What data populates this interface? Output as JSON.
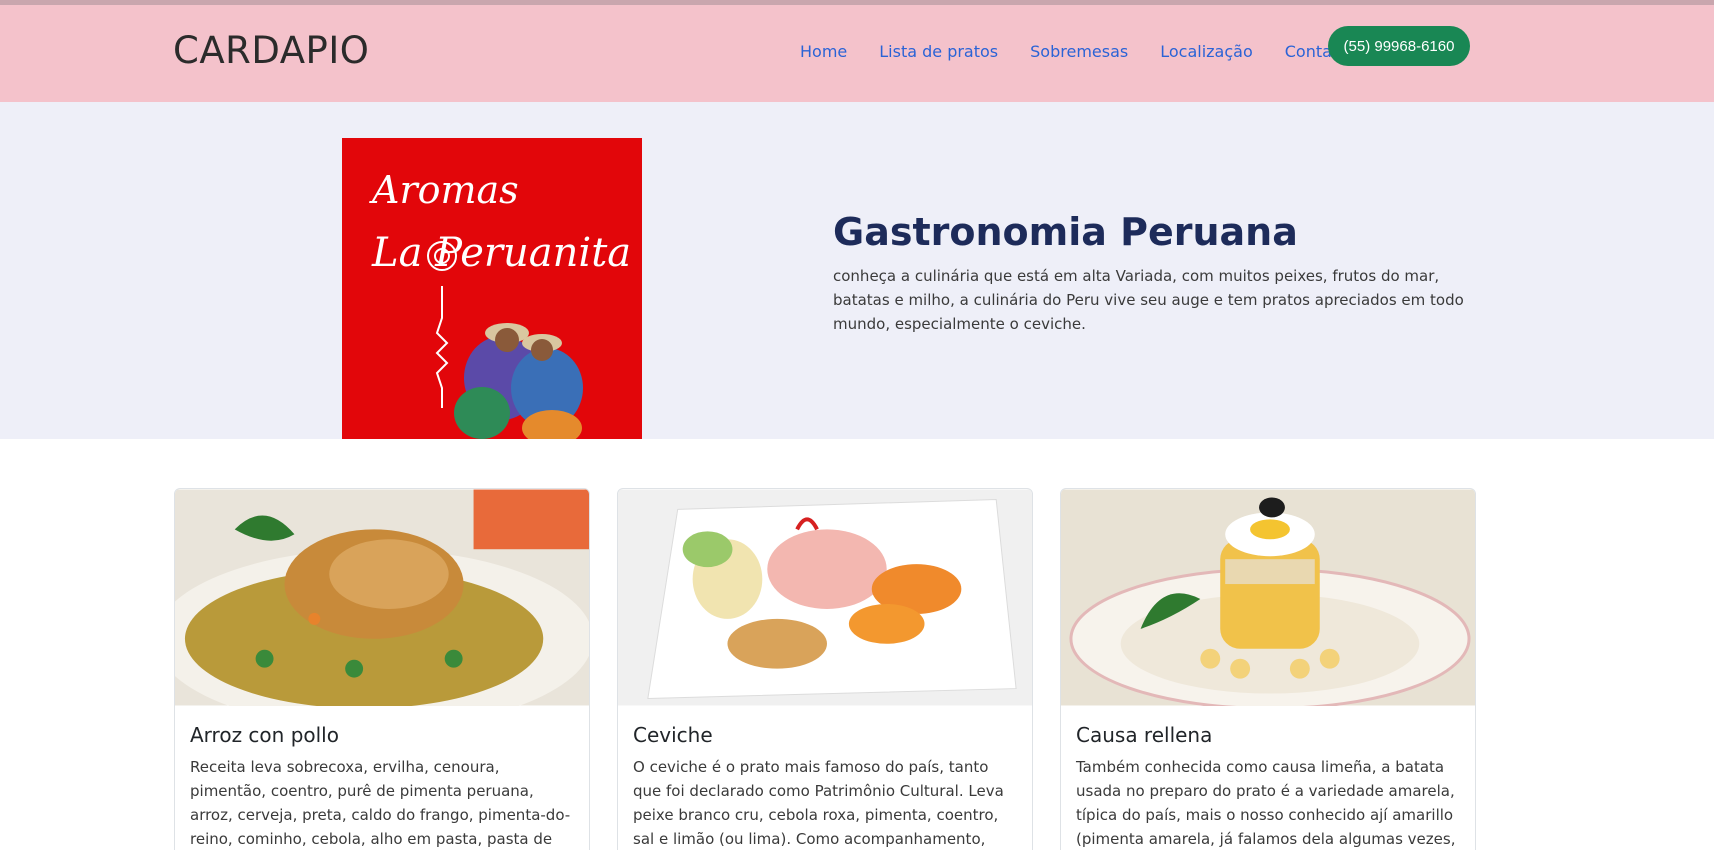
{
  "header": {
    "brand": "CARDAPIO",
    "nav": [
      "Home",
      "Lista de pratos",
      "Sobremesas",
      "Localização",
      "Contato"
    ],
    "phone_button": "(55) 99968-6160",
    "background": "#f4c2cb",
    "link_color": "#2a63d6",
    "button_color": "#198754"
  },
  "hero": {
    "logo_line1": "Aromas",
    "logo_line2": "La Peruanita",
    "title": "Gastronomia Peruana",
    "text": "conheça a culinária que está em alta Variada, com muitos peixes, frutos do mar, batatas e milho, a culinária do Peru vive seu auge e tem pratos apreciados em todo mundo, especialmente o ceviche.",
    "background": "#eeeff8",
    "logo_color": "#e2060a"
  },
  "cards": [
    {
      "title": "Arroz con pollo",
      "text": "Receita leva sobrecoxa, ervilha, cenoura, pimentão, coentro, purê de pimenta peruana, arroz, cerveja, preta, caldo do frango, pimenta-do-reino, cominho, cebola, alho em pasta, pasta de pimentão, cebola e",
      "image": "rice-with-chicken-photo"
    },
    {
      "title": "Ceviche",
      "text": "O ceviche é o prato mais famoso do país, tanto que foi declarado como Patrimônio Cultural. Leva peixe branco cru, cebola roxa, pimenta, coentro, sal e limão (ou lima). Como acompanhamento, costuma-se servir",
      "image": "ceviche-photo"
    },
    {
      "title": "Causa rellena",
      "text": "Também conhecida como causa limeña, a batata usada no preparo do prato é a variedade amarela, típica do país, mais o nosso conhecido ají amarillo (pimenta amarela, já falamos dela algumas vezes,",
      "image": "causa-rellena-photo"
    }
  ]
}
